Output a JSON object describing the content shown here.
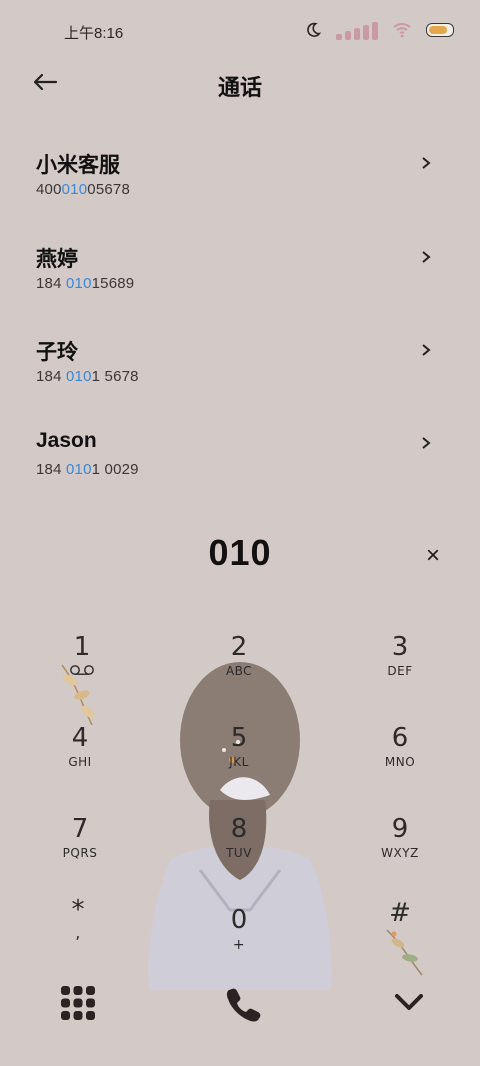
{
  "status": {
    "time": "上午8:16",
    "icons": [
      "moon-icon",
      "signal-icon",
      "wifi-icon",
      "battery-icon"
    ]
  },
  "header": {
    "title": "通话",
    "back_icon": "back-arrow-icon"
  },
  "contacts": [
    {
      "name": "小米客服",
      "num_pre": "400",
      "num_hl": "010",
      "num_post": "05678"
    },
    {
      "name": "燕婷",
      "num_pre": "184 ",
      "num_hl": "010",
      "num_post": "15689"
    },
    {
      "name": "子玲",
      "num_pre": "184 ",
      "num_hl": "010",
      "num_post": "1 5678"
    },
    {
      "name": "Jason",
      "num_pre": "184 ",
      "num_hl": "010",
      "num_post": "1 0029"
    }
  ],
  "dial": {
    "typed": "010",
    "clear": "×"
  },
  "keypad": [
    {
      "d": "1",
      "l": "⌕"
    },
    {
      "d": "2",
      "l": "ABC"
    },
    {
      "d": "3",
      "l": "DEF"
    },
    {
      "d": "4",
      "l": "GHI"
    },
    {
      "d": "5",
      "l": "JKL"
    },
    {
      "d": "6",
      "l": "MNO"
    },
    {
      "d": "7",
      "l": "PQRS"
    },
    {
      "d": "8",
      "l": "TUV"
    },
    {
      "d": "9",
      "l": "WXYZ"
    },
    {
      "d": "*",
      "l": ","
    },
    {
      "d": "0",
      "l": "+"
    },
    {
      "d": "#",
      "l": ""
    }
  ],
  "bottom": {
    "left_icon": "dialpad-grid-icon",
    "middle_icon": "phone-call-icon",
    "right_icon": "chevron-down-icon"
  },
  "colors": {
    "background": "#d3c9c7",
    "highlight": "#3b88d8"
  }
}
